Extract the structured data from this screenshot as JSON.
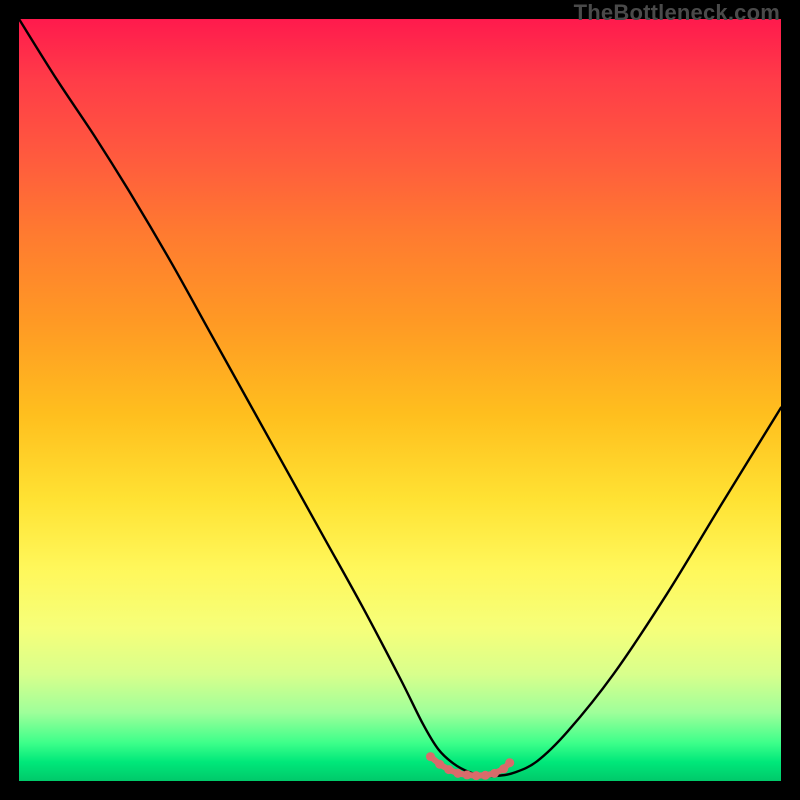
{
  "watermark": "TheBottleneck.com",
  "colors": {
    "frame": "#000000",
    "gradient_top": "#ff1a4d",
    "gradient_bottom": "#00c96a",
    "curve": "#000000",
    "marker": "#d96b6b"
  },
  "chart_data": {
    "type": "line",
    "title": "",
    "xlabel": "",
    "ylabel": "",
    "xlim": [
      0,
      100
    ],
    "ylim": [
      0,
      100
    ],
    "series": [
      {
        "name": "bottleneck-curve",
        "x": [
          0,
          5,
          10,
          15,
          20,
          25,
          30,
          35,
          40,
          45,
          50,
          53,
          55,
          57,
          59,
          61,
          63,
          65,
          68,
          72,
          78,
          85,
          92,
          100
        ],
        "y": [
          100,
          92,
          84.5,
          76.5,
          68,
          59,
          50,
          41,
          32,
          23,
          13.5,
          7.5,
          4.2,
          2.3,
          1.2,
          0.7,
          0.7,
          1.1,
          2.6,
          6.5,
          14,
          24.5,
          36,
          49
        ]
      }
    ],
    "markers": {
      "name": "optimal-range",
      "x": [
        54,
        55.2,
        56.4,
        57.6,
        58.8,
        60,
        61.2,
        62.4,
        63.6,
        64.4
      ],
      "y": [
        3.2,
        2.2,
        1.5,
        1.0,
        0.8,
        0.7,
        0.75,
        1.0,
        1.6,
        2.4
      ]
    }
  }
}
